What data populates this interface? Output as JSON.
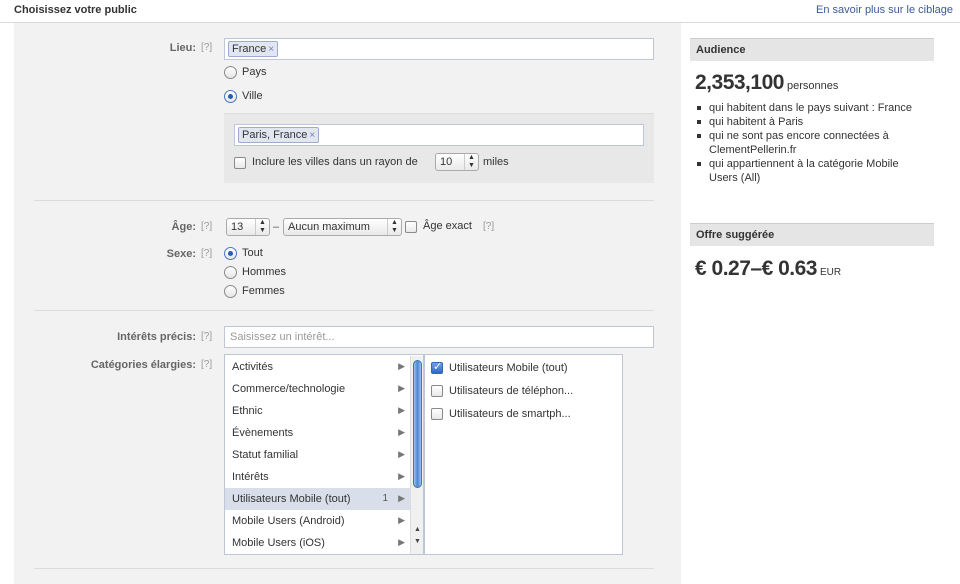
{
  "header": {
    "title": "Choisissez votre public",
    "learn_more_link": "En savoir plus sur le ciblage"
  },
  "help_marker": "[?]",
  "location": {
    "label": "Lieu:",
    "tokens": [
      "France"
    ],
    "options": [
      {
        "label": "Pays",
        "selected": false
      },
      {
        "label": "Ville",
        "selected": true
      }
    ],
    "city_tokens": [
      "Paris, France"
    ],
    "radius_checkbox_label": "Inclure les villes dans un rayon de",
    "radius_value": "10",
    "radius_unit": "miles",
    "radius_checked": false
  },
  "age": {
    "label": "Âge:",
    "min": "13",
    "separator": "–",
    "max": "Aucun maximum",
    "exact_label": "Âge exact",
    "exact_checked": false
  },
  "gender": {
    "label": "Sexe:",
    "options": [
      {
        "label": "Tout",
        "selected": true
      },
      {
        "label": "Hommes",
        "selected": false
      },
      {
        "label": "Femmes",
        "selected": false
      }
    ]
  },
  "precise_interests": {
    "label": "Intérêts précis:",
    "placeholder": "Saisissez un intérêt..."
  },
  "broad_categories": {
    "label": "Catégories élargies:",
    "categories": [
      {
        "label": "Activités",
        "count": ""
      },
      {
        "label": "Commerce/technologie",
        "count": ""
      },
      {
        "label": "Ethnic",
        "count": ""
      },
      {
        "label": "Évènements",
        "count": ""
      },
      {
        "label": "Statut familial",
        "count": ""
      },
      {
        "label": "Intérêts",
        "count": ""
      },
      {
        "label": "Utilisateurs Mobile (tout)",
        "count": "1",
        "selected": true
      },
      {
        "label": "Mobile Users (Android)",
        "count": ""
      },
      {
        "label": "Mobile Users (iOS)",
        "count": ""
      }
    ],
    "subcategories": [
      {
        "label": "Utilisateurs Mobile (tout)",
        "checked": true
      },
      {
        "label": "Utilisateurs de téléphon...",
        "checked": false
      },
      {
        "label": "Utilisateurs de smartph...",
        "checked": false
      }
    ]
  },
  "audience": {
    "heading": "Audience",
    "count": "2,353,100",
    "unit": "personnes",
    "criteria": [
      "qui habitent dans le pays suivant : France",
      "qui habitent à Paris",
      "qui ne sont pas encore connectées à ClementPellerin.fr",
      "qui appartiennent à la catégorie Mobile Users (All)"
    ]
  },
  "suggested_bid": {
    "heading": "Offre suggérée",
    "range": "€ 0.27–€ 0.63",
    "currency": "EUR"
  }
}
